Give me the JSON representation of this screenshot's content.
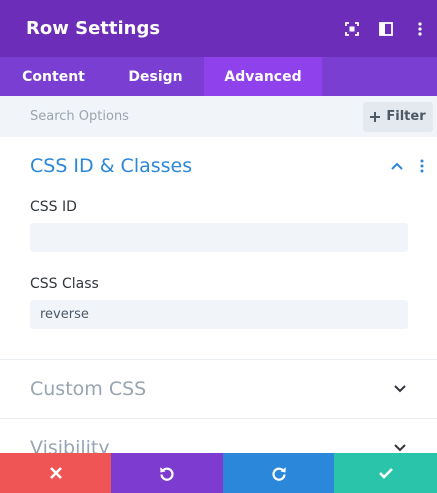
{
  "header": {
    "title": "Row Settings"
  },
  "tabs": [
    {
      "label": "Content"
    },
    {
      "label": "Design"
    },
    {
      "label": "Advanced"
    }
  ],
  "search": {
    "placeholder": "Search Options",
    "filter_label": "Filter"
  },
  "sections": {
    "css": {
      "title": "CSS ID & Classes",
      "fields": [
        {
          "label": "CSS ID",
          "value": ""
        },
        {
          "label": "CSS Class",
          "value": "reverse"
        }
      ]
    },
    "custom_css": {
      "title": "Custom CSS"
    },
    "visibility": {
      "title": "Visibility"
    }
  },
  "colors": {
    "header_bg": "#6c2eb9",
    "tab_bar_bg": "#7b3ed2",
    "active_tab_bg": "#8f42ec",
    "accent_blue": "#2b87da",
    "cancel": "#ef5555",
    "undo": "#7e3bd0",
    "redo": "#2b87da",
    "save": "#29c4a9"
  },
  "footer": {
    "buttons": [
      {
        "icon": "close-icon"
      },
      {
        "icon": "undo-icon"
      },
      {
        "icon": "redo-icon"
      },
      {
        "icon": "check-icon"
      }
    ]
  }
}
